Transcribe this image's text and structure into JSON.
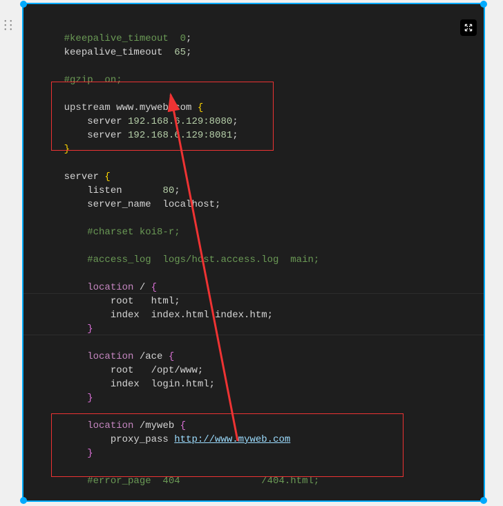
{
  "code": {
    "l1a": "#keepalive_timeout  0",
    "l1b": ";",
    "l2a": "keepalive_timeout  ",
    "l2b": "65",
    "l2c": ";",
    "l4": "#gzip  on;",
    "l6a": "upstream",
    "l6b": " www.myweb.com ",
    "l6c": "{",
    "l7a": "    server ",
    "l7b": "192.168.6.129:8080",
    "l7c": ";",
    "l8a": "    server ",
    "l8b": "192.168.6.129:8081",
    "l8c": ";",
    "l9": "}",
    "l11a": "server",
    "l11b": " {",
    "l12a": "    listen       ",
    "l12b": "80",
    "l12c": ";",
    "l13a": "    server_name  localhost",
    "l13b": ";",
    "l15": "    #charset koi8-r;",
    "l17": "    #access_log  logs/host.access.log  main;",
    "l19a": "    location",
    "l19b": " / ",
    "l19c": "{",
    "l20a": "        root   html",
    "l20b": ";",
    "l21a": "        index  index.html index.htm",
    "l21b": ";",
    "l22": "    }",
    "l24a": "    location",
    "l24b": " /ace ",
    "l24c": "{",
    "l25a": "        root   /opt/www",
    "l25b": ";",
    "l26a": "        index  login.html",
    "l26b": ";",
    "l27": "    }",
    "l29a": "    location",
    "l29b": " /myweb ",
    "l29c": "{",
    "l30a": "        proxy_pass ",
    "l30b": "http://www.myweb.com",
    "l31": "    }",
    "l33": "    #error_page  404              /404.html;"
  },
  "annotations": {
    "box1": {
      "desc": "upstream-block-highlight"
    },
    "box2": {
      "desc": "location-myweb-highlight"
    },
    "arrow": {
      "from": "proxy_pass url",
      "to": "upstream server",
      "color": "#e33"
    }
  }
}
